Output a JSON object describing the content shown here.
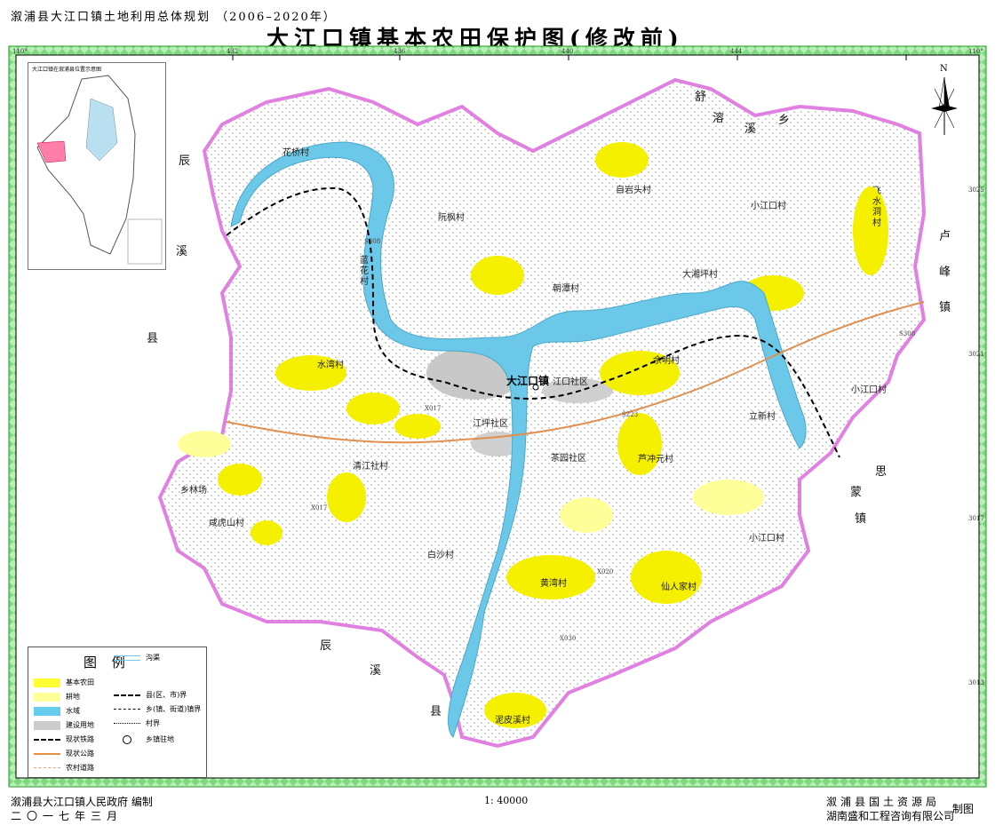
{
  "header": {
    "plan_title": "溆浦县大江口镇土地利用总体规划 （2006–2020年）",
    "main_title": "大江口镇基本农田保护图(修改前)"
  },
  "map": {
    "town_name": "大江口镇",
    "villages": [
      "花桥村",
      "阮枫村",
      "蓝花村",
      "朝潭村",
      "自岩头村",
      "小江口村",
      "大湘坪村",
      "余明村",
      "水湾村",
      "江口社区",
      "江坪社区",
      "立新村",
      "茶园社区",
      "芦冲元村",
      "清江社村",
      "乡林场",
      "咸虎山村",
      "白沙村",
      "黄湾村",
      "仙人家村",
      "小江口村",
      "泥皮溪村",
      "小江口村",
      "飞水洞村"
    ],
    "regions": [
      "舒",
      "溶",
      "溪",
      "乡",
      "辰",
      "溪",
      "县",
      "卢",
      "峰",
      "镇",
      "思",
      "蒙",
      "镇",
      "辰",
      "溪",
      "县"
    ],
    "roads": [
      "S308",
      "X017",
      "X020",
      "X030",
      "S308",
      "S223",
      "X017"
    ],
    "coords": {
      "lon_top": [
        "110°",
        "432",
        "436",
        "440",
        "444",
        "110°"
      ],
      "lat_left": [
        "3025",
        "3021",
        "3017",
        "3013"
      ]
    }
  },
  "inset": {
    "title": "大江口镇在溆浦县位置示意图"
  },
  "compass": {
    "north": "N"
  },
  "legend": {
    "title": "图 例",
    "items": [
      {
        "label": "基本农田",
        "color": "#ffff33"
      },
      {
        "label": "耕地",
        "color": "#ffff99"
      },
      {
        "label": "水域",
        "color": "#66ccee"
      },
      {
        "label": "建设用地",
        "color": "#cccccc"
      },
      {
        "label": "现状铁路",
        "color": "#000000"
      },
      {
        "label": "现状公路",
        "color": "#e69040"
      },
      {
        "label": "农村道路",
        "color": "#e6a080"
      }
    ],
    "items_right": [
      {
        "label": "沟渠"
      },
      {
        "label": "县(区、市)界"
      },
      {
        "label": "乡(镇、街道)镇界"
      },
      {
        "label": "村界"
      },
      {
        "label": "乡镇驻地"
      }
    ]
  },
  "footer": {
    "org_left": "溆浦县大江口镇人民政府 编制",
    "date": "二〇一七年三月",
    "scale": "1: 40000",
    "org_right_1": "溆浦县国土资源局",
    "org_right_2": "湖南盛和工程咨询有限公司",
    "make": "制图"
  }
}
